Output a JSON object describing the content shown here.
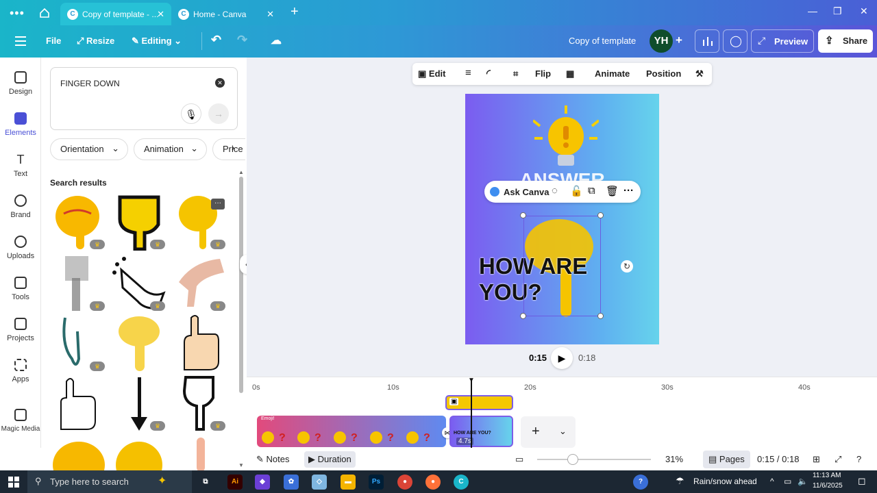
{
  "browser": {
    "tabs": [
      {
        "label": "Copy of template - ..."
      },
      {
        "label": "Home - Canva"
      }
    ]
  },
  "header": {
    "file": "File",
    "resize": "Resize",
    "editing": "Editing",
    "doc_title": "Copy of template",
    "avatar_initials": "YH",
    "preview": "Preview",
    "share": "Share"
  },
  "rail": {
    "items": [
      {
        "label": "Design"
      },
      {
        "label": "Elements"
      },
      {
        "label": "Text"
      },
      {
        "label": "Brand"
      },
      {
        "label": "Uploads"
      },
      {
        "label": "Tools"
      },
      {
        "label": "Projects"
      },
      {
        "label": "Apps"
      },
      {
        "label": "Magic Media"
      }
    ]
  },
  "panel": {
    "query": "FINGER DOWN",
    "chips": [
      "Orientation",
      "Animation",
      "Price"
    ],
    "results_title": "Search results"
  },
  "canvas": {
    "toolbar": {
      "edit": "Edit",
      "flip": "Flip",
      "animate": "Animate",
      "position": "Position"
    },
    "answer_text": "ANSWER",
    "main_text": "HOW ARE YOU?",
    "ask_canva": "Ask Canva",
    "current_time": "0:15",
    "total_time": "0:18"
  },
  "timeline": {
    "ticks": [
      "0s",
      "10s",
      "20s",
      "30s",
      "40s"
    ],
    "clip_duration": "4.7s",
    "clip1_label": "Emoji!",
    "clip2_label": "HOW ARE YOU?"
  },
  "bottombar": {
    "notes": "Notes",
    "duration": "Duration",
    "zoom": "31%",
    "pages": "Pages",
    "time": "0:15 / 0:18"
  },
  "taskbar": {
    "search_placeholder": "Type here to search",
    "weather": "Rain/snow ahead",
    "time": "11:13 AM",
    "date": "11/6/2025"
  },
  "colors": {
    "accent": "#4a50d6",
    "header_start": "#1ab5c9",
    "header_end": "#5a55d8",
    "page_start": "#7b5cf0",
    "page_end": "#66d3ec",
    "emoji_yellow": "#f5c800"
  }
}
